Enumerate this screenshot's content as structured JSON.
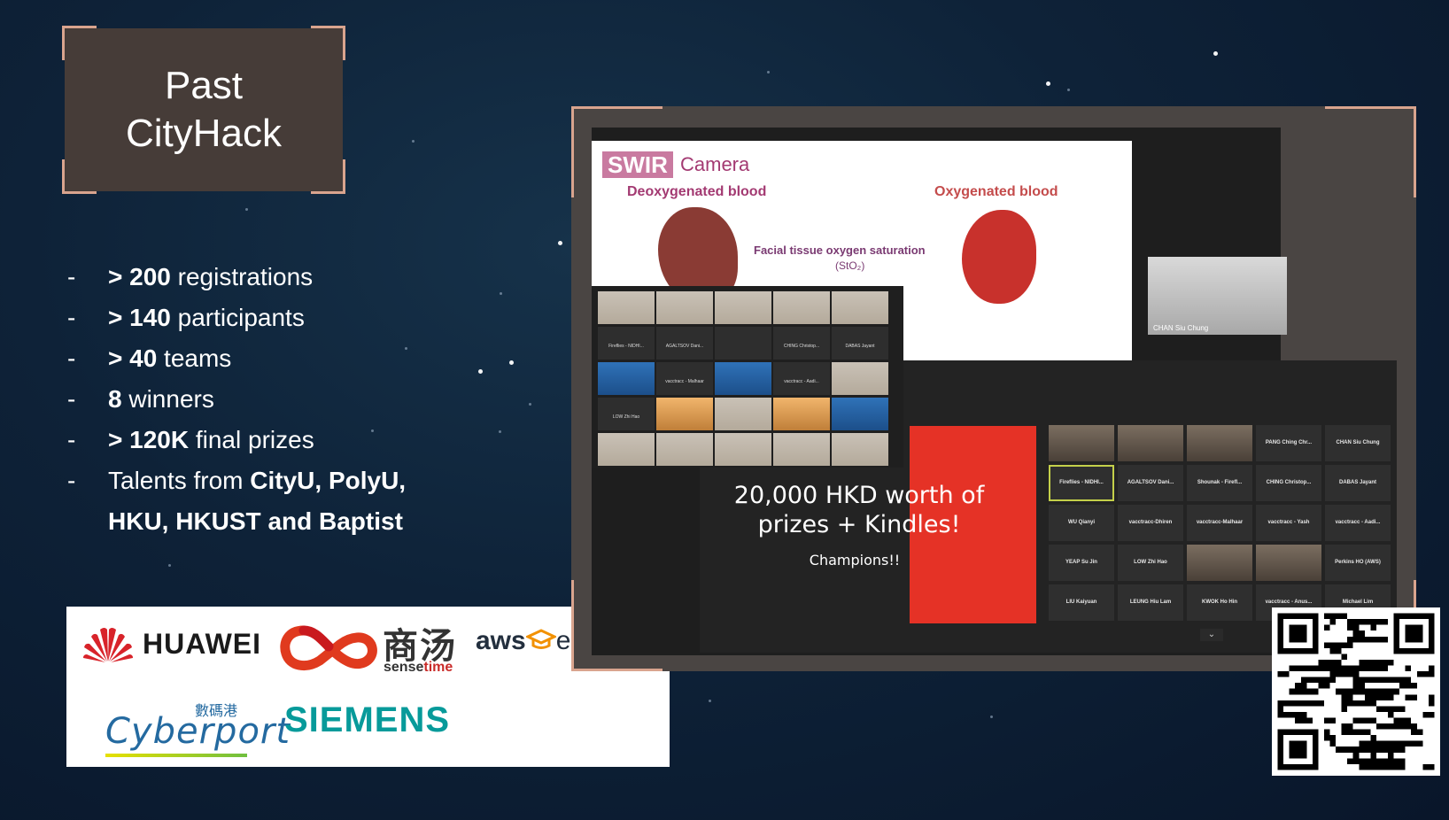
{
  "title": {
    "line1": "Past",
    "line2": "CityHack"
  },
  "bullets": [
    {
      "dash": "-",
      "bold": "> 200",
      "rest": " registrations"
    },
    {
      "dash": "-",
      "bold": "> 140",
      "rest": " participants"
    },
    {
      "dash": "-",
      "bold": "> 40",
      "rest": " teams"
    },
    {
      "dash": "-",
      "bold": "8",
      "rest": " winners"
    },
    {
      "dash": "-",
      "bold": "> 120K",
      "rest": " final prizes"
    }
  ],
  "talents": {
    "dash": "-",
    "prefix": "Talents from ",
    "schools1": "CityU, PolyU,",
    "schools2": "HKU, HKUST and Baptist"
  },
  "sponsors": {
    "huawei": "HUAWEI",
    "sensetime_cn": "商汤",
    "sensetime_en_a": "sense",
    "sensetime_en_b": "time",
    "aws": "aws",
    "aws_educate": "educate",
    "cyberport_cn": "數碼港",
    "cyberport": "Cyberport",
    "siemens": "SIEMENS"
  },
  "slide": {
    "swir": "SWIR",
    "camera": "Camera",
    "deoxy": "Deoxygenated blood",
    "oxy": "Oxygenated blood",
    "facial": "Facial tissue oxygen saturation",
    "sto2": "(StO₂)"
  },
  "camera_feed": {
    "name": "CHAN Siu Chung"
  },
  "gallery_names": [
    "",
    "",
    "",
    "",
    "",
    "Fireflies - NIDHI...",
    "AGALTSOV Dani...",
    "",
    "CHING Christop...",
    "DABAS Jayant",
    "",
    "vacctracc - Malhaar",
    "",
    "vacctracc - Aadi...",
    "",
    "LOW Zhi Hao",
    "",
    "",
    "",
    "",
    "",
    "",
    "",
    "",
    ""
  ],
  "prize_slide": {
    "line1": "20,000 HKD worth of",
    "line2": "prizes + Kindles!",
    "champions": "Champions!!"
  },
  "participants": [
    "",
    "",
    "",
    "PANG Ching Chr...",
    "CHAN Siu Chung",
    "Fireflies - NIDHI...",
    "AGALTSOV Dani...",
    "Shounak - Firefl...",
    "CHING Christop...",
    "DABAS Jayant",
    "WU Qianyi",
    "vacctracc-Dhiren",
    "vacctracc-Malhaar",
    "vacctracc - Yash",
    "vacctracc - Aadi...",
    "YEAP Su Jin",
    "LOW Zhi Hao",
    "",
    "",
    "Perkins HO (AWS)",
    "LIU Kaiyuan",
    "LEUNG Hiu Lam",
    "KWOK Ho Hin",
    "vacctracc - Anus...",
    "Michael Lim"
  ],
  "colors": {
    "background": "#0e2238",
    "accent_corner": "#d9a48e",
    "title_box": "#463c38",
    "prize_red": "#e53226"
  },
  "icons": [
    "huawei-logo-icon",
    "sensetime-logo-icon",
    "aws-educate-logo-icon",
    "cyberport-logo-icon",
    "qr-code-icon",
    "chevron-down-icon"
  ]
}
